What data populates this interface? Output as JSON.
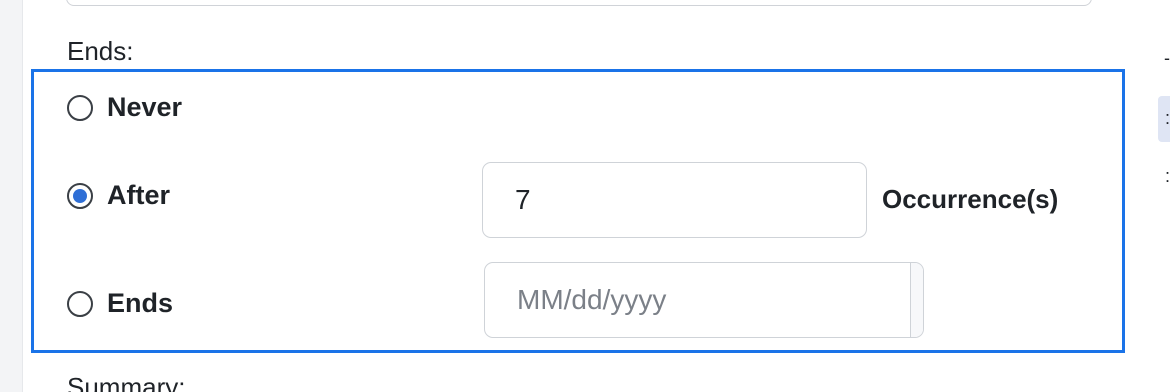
{
  "ends": {
    "label": "Ends:",
    "options": [
      {
        "label": "Never",
        "checked": false
      },
      {
        "label": "After",
        "checked": true
      },
      {
        "label": "Ends",
        "checked": false
      }
    ],
    "occurrences": {
      "value": "7",
      "suffix": "Occurrence(s)"
    },
    "end_date": {
      "value": "",
      "placeholder": "MM/dd/yyyy",
      "icon": "calendar-icon"
    }
  },
  "summary": {
    "label": "Summary:"
  },
  "colors": {
    "focus_border": "#1a73e8",
    "radio_selected": "#2f6fd6",
    "input_border": "#cfd3d8"
  }
}
